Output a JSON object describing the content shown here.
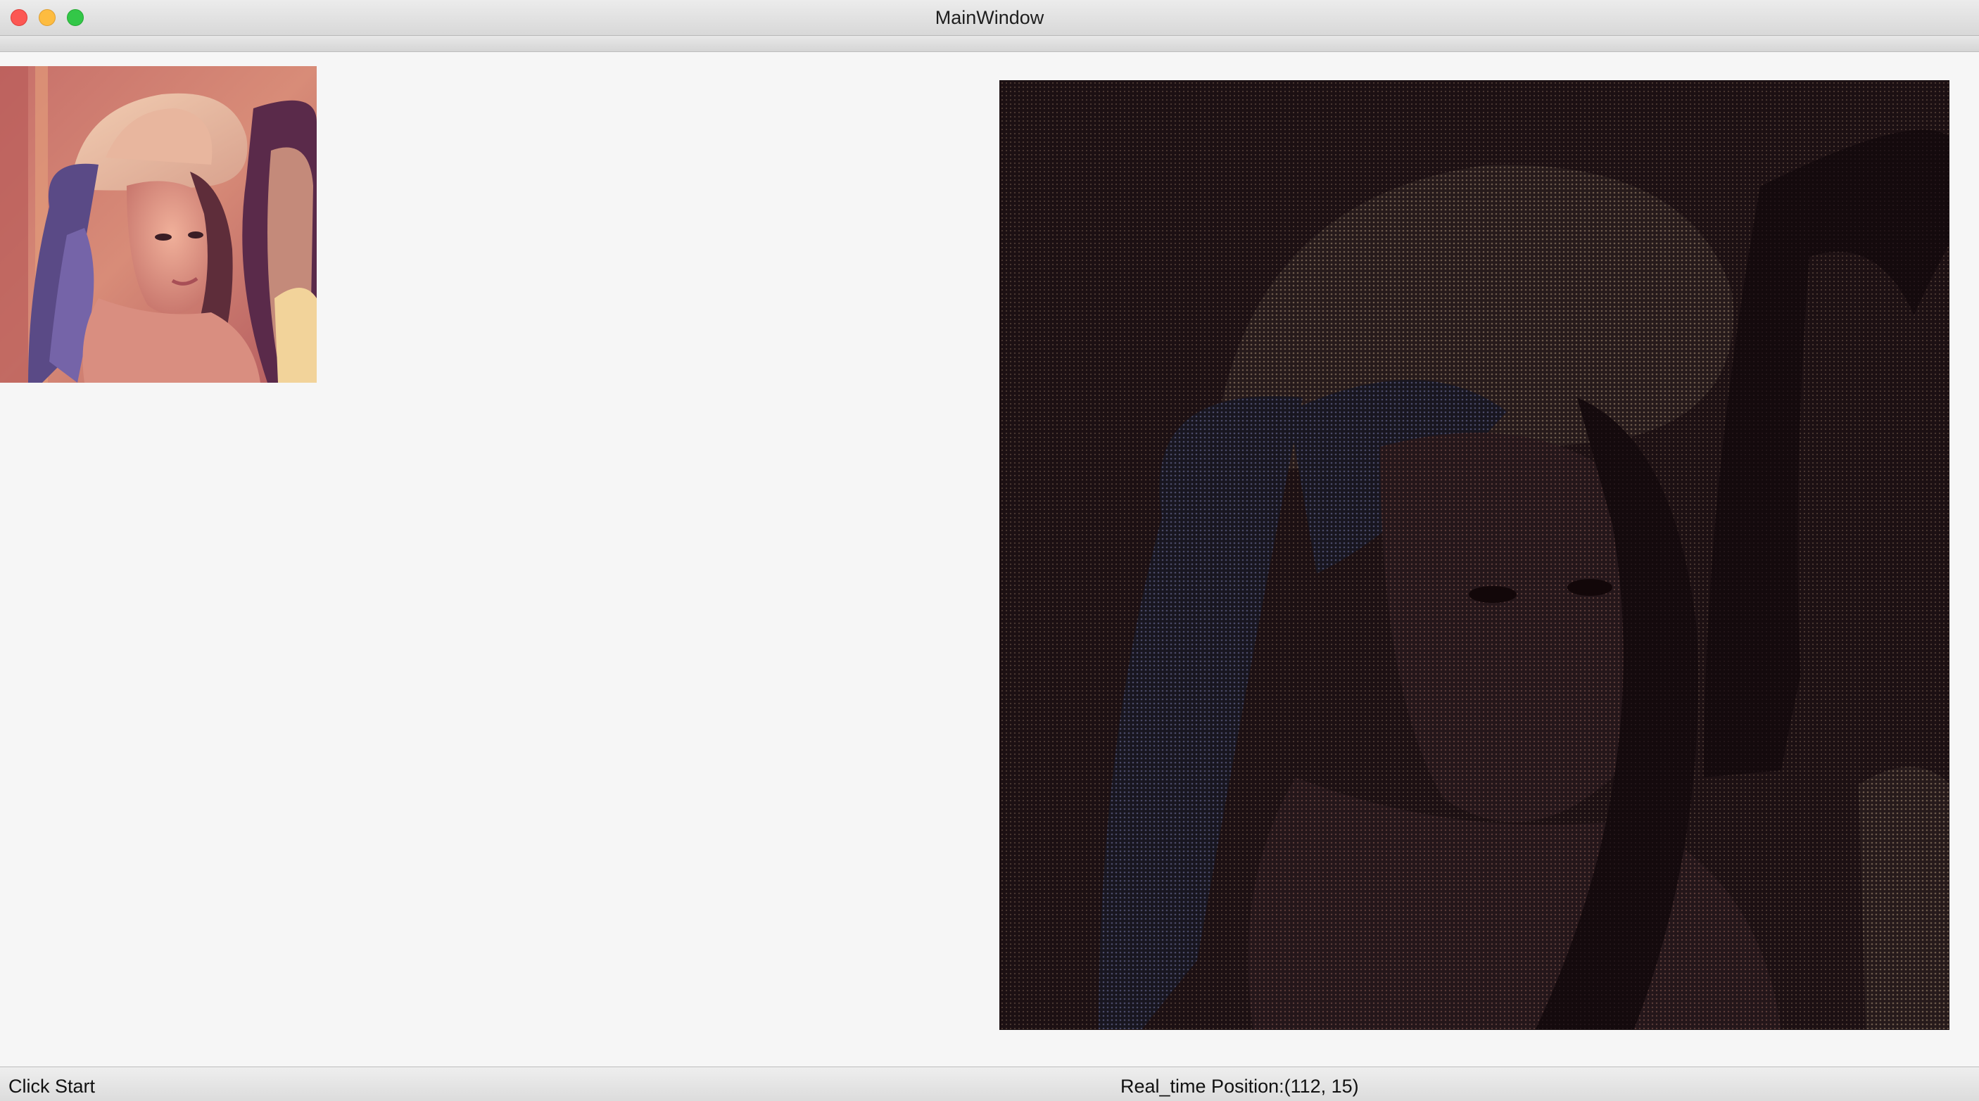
{
  "window": {
    "title": "MainWindow"
  },
  "status": {
    "left_text": "Click Start",
    "position_text": "Real_time Position:(112, 15)"
  },
  "icons": {
    "close": "close-icon",
    "minimize": "minimize-icon",
    "maximize": "maximize-icon"
  },
  "colors": {
    "window_bg": "#f6f6f6",
    "close": "#fc5753",
    "minimize": "#fdbc40",
    "maximize": "#33c748"
  }
}
